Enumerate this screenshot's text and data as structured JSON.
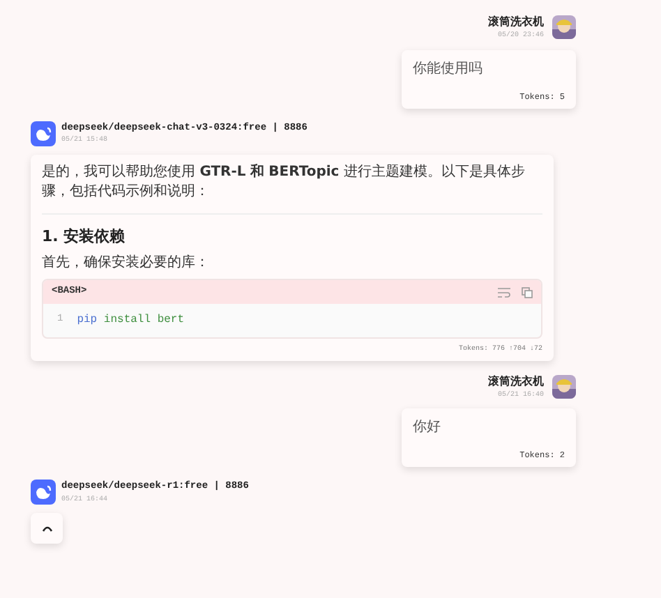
{
  "messages": [
    {
      "kind": "user",
      "name": "滚筒洗衣机",
      "time": "05/20 23:46",
      "text": "你能使用吗",
      "tokens": "Tokens: 5"
    },
    {
      "kind": "assistant",
      "name": "deepseek/deepseek-chat-v3-0324:free | 8886",
      "time": "05/21 15:48",
      "blocks": [
        {
          "kind": "paragraph",
          "text": "是的，我可以帮助您使用 **GTR-L** **和** **BERTopic** 进行主题建模。以下是具体步骤，包括代码示例和说明："
        },
        {
          "kind": "divider"
        },
        {
          "kind": "heading",
          "text": "1. 安装依赖"
        },
        {
          "kind": "paragraph",
          "text": "首先，确保安装必要的库："
        },
        {
          "kind": "code",
          "language": "<BASH>",
          "lines": [
            {
              "number": "1",
              "command": "pip",
              "args": "install bert"
            }
          ]
        }
      ],
      "tokens": "Tokens: 776 ↑704 ↓72"
    },
    {
      "kind": "user",
      "name": "滚筒洗衣机",
      "time": "05/21 16:40",
      "text": "你好",
      "tokens": "Tokens: 2"
    },
    {
      "kind": "assistant",
      "name": "deepseek/deepseek-r1:free | 8886",
      "time": "05/21 16:44",
      "loading": true
    }
  ]
}
